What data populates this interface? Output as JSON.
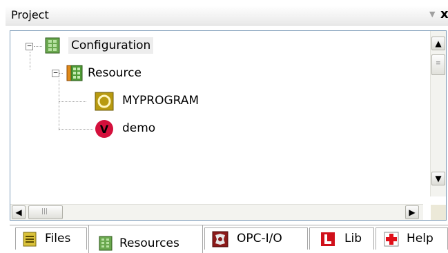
{
  "window": {
    "title": "Project",
    "pin_icon": "pin-down-arrow-icon",
    "close_label": "x"
  },
  "tree": {
    "nodes": [
      {
        "label": "Configuration",
        "icon": "configuration-icon",
        "expanded": true,
        "selected": true,
        "level": 0
      },
      {
        "label": "Resource",
        "icon": "resource-icon",
        "expanded": true,
        "level": 1
      },
      {
        "label": "MYPROGRAM",
        "icon": "program-icon",
        "level": 2
      },
      {
        "label": "demo",
        "icon": "variables-icon",
        "level": 2
      }
    ],
    "expander_minus": "−"
  },
  "scrollbars": {
    "up": "▲",
    "down": "▼",
    "left": "◀",
    "right": "▶",
    "grip": "|||"
  },
  "tabs": [
    {
      "label": "Files",
      "icon": "files-icon",
      "active": false
    },
    {
      "label": "Resources",
      "icon": "resources-icon",
      "active": true
    },
    {
      "label": "OPC-I/O",
      "icon": "opc-io-icon",
      "active": false
    },
    {
      "label": "Lib",
      "icon": "lib-icon",
      "active": false
    },
    {
      "label": "Help",
      "icon": "help-icon",
      "active": false
    }
  ],
  "colors": {
    "accent_green": "#3c8a2e",
    "program_gold": "#b8a01e",
    "variable_red": "#d4103c",
    "lib_red": "#d0101a"
  }
}
